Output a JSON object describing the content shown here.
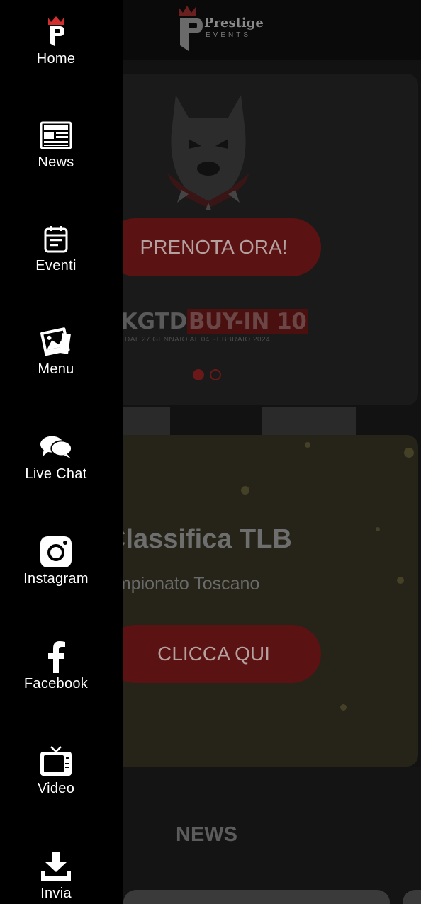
{
  "brand": {
    "name": "Prestige",
    "sub": "EVENTS"
  },
  "drawer": {
    "items": [
      {
        "label": "Home",
        "icon": "prestige-logo-icon"
      },
      {
        "label": "News",
        "icon": "newspaper-icon"
      },
      {
        "label": "Eventi",
        "icon": "calendar-icon"
      },
      {
        "label": "Menu",
        "icon": "photo-icon"
      },
      {
        "label": "Live Chat",
        "icon": "chat-bubbles-icon"
      },
      {
        "label": "Instagram",
        "icon": "instagram-icon"
      },
      {
        "label": "Facebook",
        "icon": "facebook-icon"
      },
      {
        "label": "Video",
        "icon": "tv-icon"
      },
      {
        "label": "Invia",
        "icon": "download-icon"
      }
    ]
  },
  "carousel": {
    "button_label": "PRENOTA ORA!",
    "promo_prefix": "KGTD",
    "promo_highlight": "BUY-IN 10",
    "promo_dates": "DAL 27 GENNAIO AL 04 FEBBRAIO 2024",
    "pages": 2,
    "active_page": 1
  },
  "ranking_card": {
    "title": "Classifica TLB",
    "subtitle": "ampionato Toscano",
    "button_label": "CLICCA QUI"
  },
  "news_section": {
    "title": "NEWS"
  },
  "colors": {
    "accent": "#c62828",
    "drawer_bg": "#000000",
    "text": "#ffffff"
  }
}
